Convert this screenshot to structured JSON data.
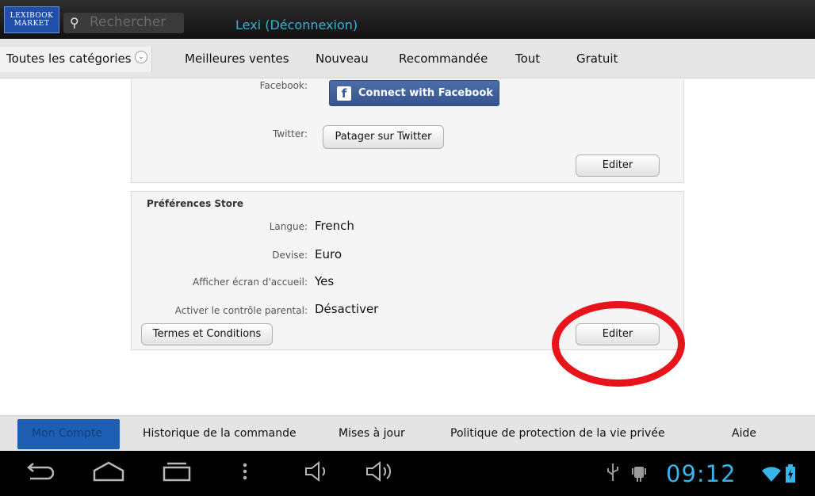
{
  "topbar": {
    "logo_line1": "LEXIBOOK",
    "logo_line2": "MARKET",
    "search_placeholder": "Rechercher",
    "user_text": "Lexi  (Déconnexion)"
  },
  "categories": {
    "dropdown_label": "Toutes les catégories",
    "items": [
      "Meilleures ventes",
      "Nouveau",
      "Recommandée",
      "Tout",
      "Gratuit"
    ]
  },
  "social": {
    "facebook_label": "Facebook:",
    "facebook_button": "Connect with Facebook",
    "twitter_label": "Twitter:",
    "twitter_button": "Patager sur Twitter",
    "edit_button": "Editer"
  },
  "preferences": {
    "title": "Préférences Store",
    "rows": [
      {
        "label": "Langue:",
        "value": "French"
      },
      {
        "label": "Devise:",
        "value": "Euro"
      },
      {
        "label": "Afficher écran d'accueil:",
        "value": "Yes"
      },
      {
        "label": "Activer le contrôle parental:",
        "value": "Désactiver"
      }
    ],
    "terms_button": "Termes et Conditions",
    "edit_button": "Editer"
  },
  "bottom_nav": {
    "active": "Mon Compte",
    "items": [
      "Historique de la commande",
      "Mises à jour",
      "Politique de protection de la vie privée",
      "Aide"
    ]
  },
  "system_bar": {
    "clock": "09:12",
    "icons": [
      "back-icon",
      "home-icon",
      "recent-apps-icon",
      "menu-icon",
      "volume-down-icon",
      "volume-up-icon",
      "usb-icon",
      "android-debug-icon",
      "wifi-icon",
      "battery-icon"
    ]
  },
  "colors": {
    "accent": "#36b3d6",
    "highlight": "#e8141c",
    "facebook": "#3b5998",
    "active_tab": "#1f5fb3"
  }
}
